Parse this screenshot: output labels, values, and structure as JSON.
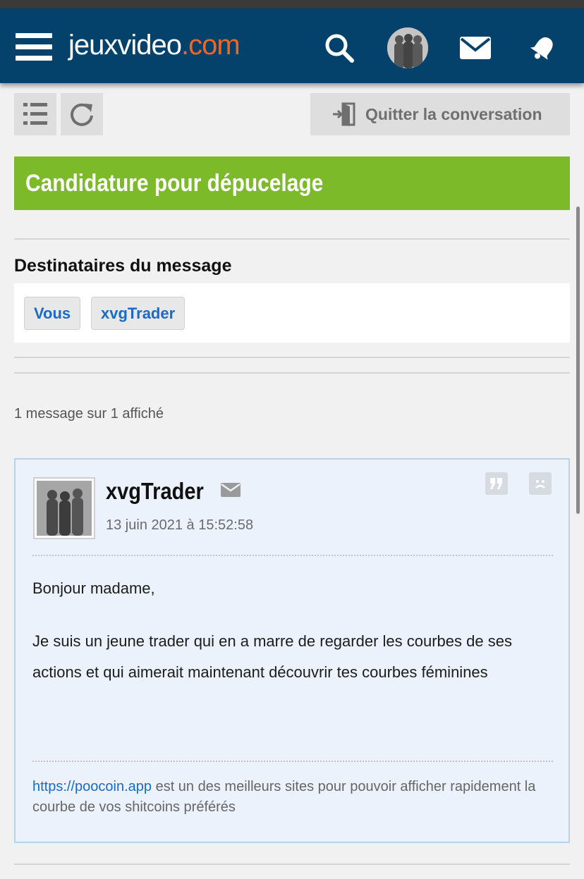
{
  "header": {
    "logo_main": "jeuxvideo",
    "logo_accent": ".com",
    "accent_color": "#f26522",
    "bar_color": "#04426b",
    "icons": [
      "menu-icon",
      "search-icon",
      "user-avatar",
      "mail-icon",
      "bell-icon"
    ]
  },
  "toolbar": {
    "quit_label": "Quitter la conversation"
  },
  "conversation": {
    "title": "Candidature pour dépucelage",
    "title_color": "#7dba2a"
  },
  "recipients": {
    "heading": "Destinataires du message",
    "items": [
      "Vous",
      "xvgTrader"
    ]
  },
  "message_count": "1 message sur 1 affiché",
  "message": {
    "author": "xvgTrader",
    "date": "13 juin 2021 à 15:52:58",
    "paragraphs": [
      "Bonjour madame,",
      "Je suis un jeune trader qui en a marre de regarder les courbes de ses actions et qui aimerait maintenant découvrir tes courbes féminines"
    ],
    "signature": {
      "link": "https://poocoin.app",
      "text": " est un des meilleurs sites pour pouvoir afficher rapidement la courbe de vos shitcoins préférés"
    }
  }
}
